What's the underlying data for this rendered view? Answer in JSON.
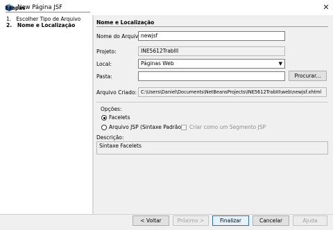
{
  "window": {
    "title": "New Página JSF",
    "close_glyph": "✕"
  },
  "steps": {
    "title": "Etapas",
    "items": [
      {
        "number": "1.",
        "label": "Escolher Tipo de Arquivo"
      },
      {
        "number": "2.",
        "label": "Nome e Localização"
      }
    ]
  },
  "panel": {
    "title": "Nome e Localização",
    "file_name_label": "Nome do Arquivo:",
    "file_name_value": "newjsf",
    "project_label": "Projeto:",
    "project_value": "INE5612TrabIII",
    "location_label": "Local:",
    "location_value": "Páginas Web",
    "folder_label": "Pasta:",
    "folder_value": "",
    "browse_button": "Procurar...",
    "created_file_label": "Arquivo Criado:",
    "created_file_value": "C:\\Users\\Daniel\\Documents\\NetBeansProjects\\INE5612TrabIII\\web\\newjsf.xhtml"
  },
  "options": {
    "label": "Opções:",
    "facelets": {
      "label": "Facelets",
      "selected": true
    },
    "jsp": {
      "label": "Arquivo JSP (Sintaxe Padrão)",
      "selected": false
    },
    "segment": {
      "label": "Criar como um Segmento JSP",
      "checked": false,
      "enabled": false
    },
    "description_label": "Descrição:",
    "description_value": "Sintaxe Facelets"
  },
  "buttons": {
    "back": "< Voltar",
    "next": "Próximo >",
    "finish": "Finalizar",
    "cancel": "Cancelar",
    "help": "Ajuda"
  },
  "colors": {
    "window_bg": "#f0f0f0",
    "default_button_border": "#2b6cb8",
    "disabled_text": "#a0a0a0"
  }
}
